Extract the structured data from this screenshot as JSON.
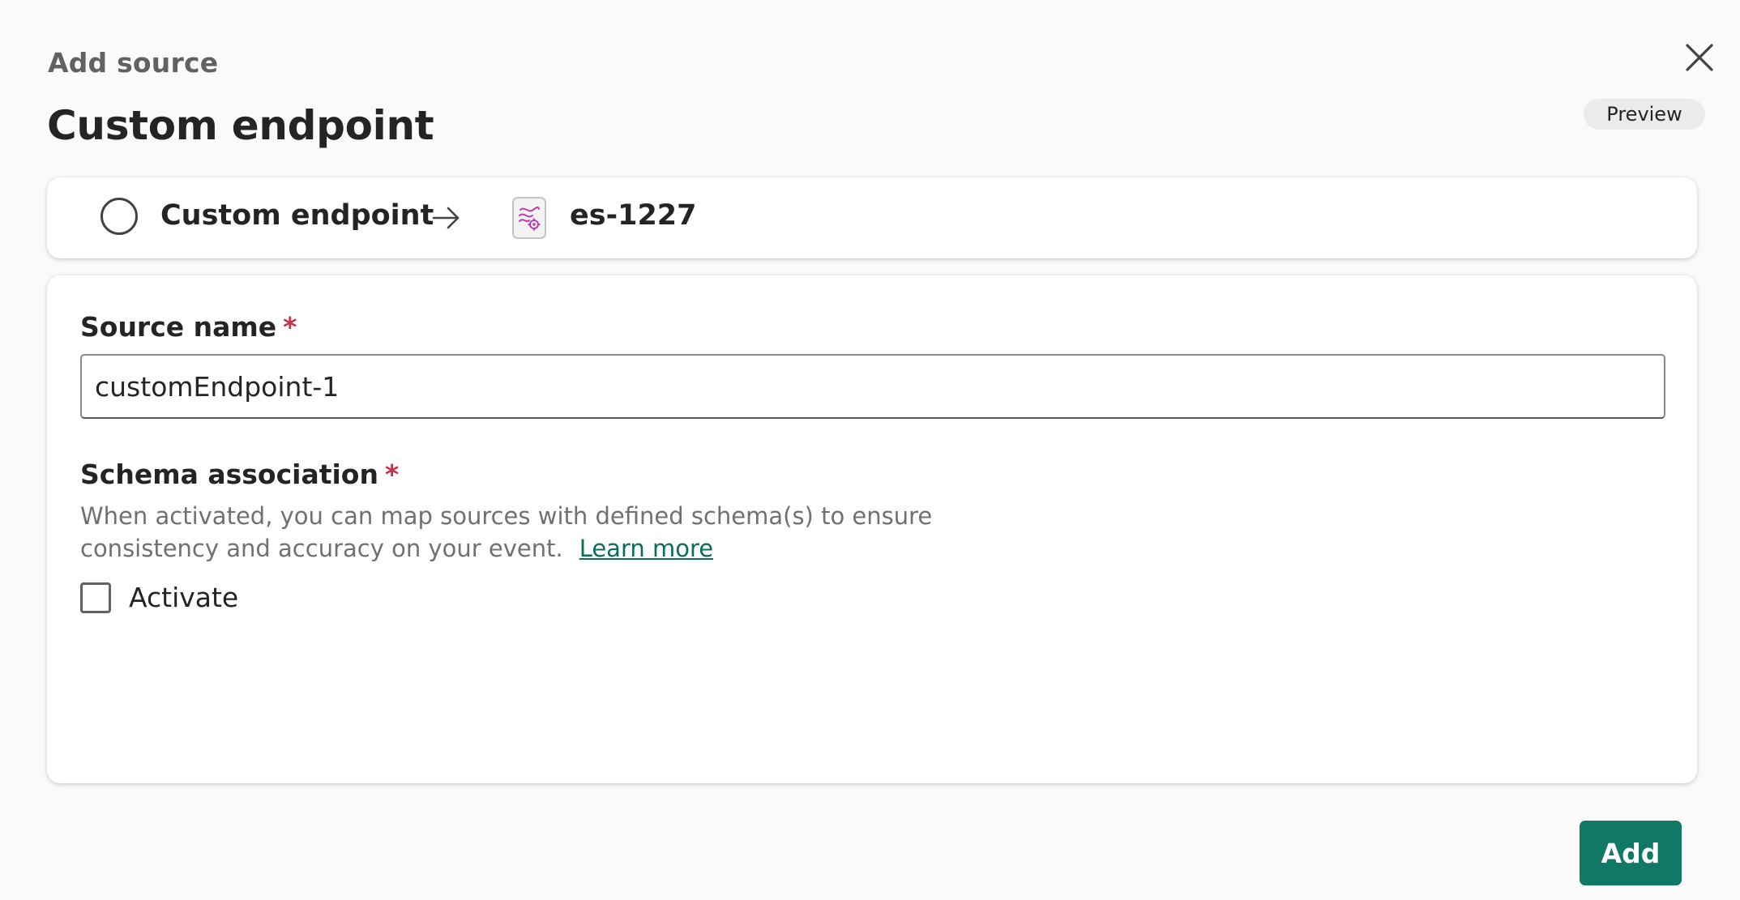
{
  "dialog": {
    "eyebrow": "Add source",
    "title": "Custom endpoint",
    "preview_badge": "Preview"
  },
  "flow": {
    "source_label": "Custom endpoint",
    "destination_label": "es-1227",
    "destination_icon": "eventstream-icon"
  },
  "form": {
    "source_name": {
      "label": "Source name",
      "required_marker": "*",
      "value": "customEndpoint-1"
    },
    "schema_association": {
      "label": "Schema association",
      "required_marker": "*",
      "help_text": "When activated, you can map sources with defined schema(s) to ensure consistency and accuracy on your event.",
      "link_text": "Learn more"
    },
    "activate": {
      "label": "Activate",
      "checked": false
    }
  },
  "footer": {
    "add_label": "Add"
  },
  "colors": {
    "accent": "#117865",
    "link": "#0f6c5a",
    "required": "#c4314b",
    "eventstream_icon": "#c239b3"
  }
}
